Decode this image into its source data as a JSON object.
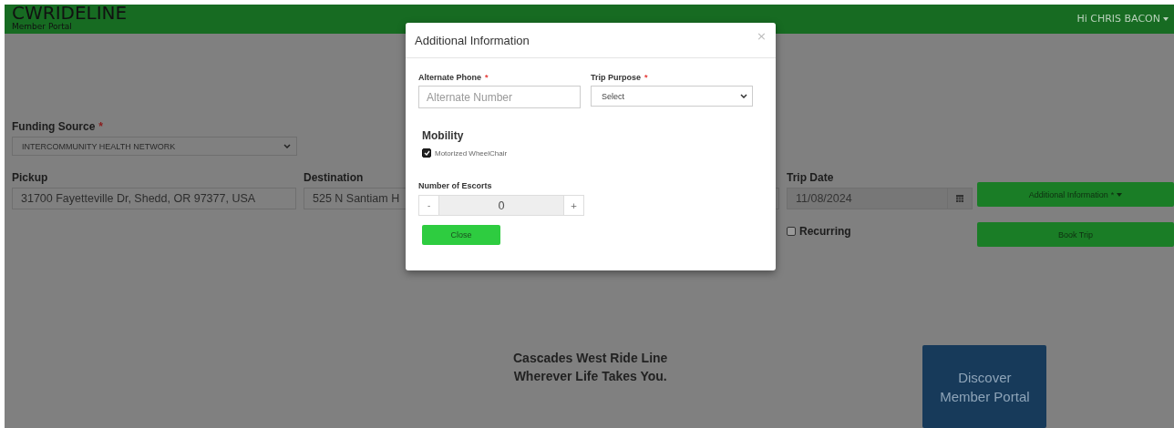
{
  "header": {
    "brand": "CWRIDELINE",
    "subtitle": "Member Portal",
    "user": "Hi CHRIS BACON"
  },
  "form": {
    "funding": {
      "label": "Funding Source",
      "required_mark": "*",
      "value": "INTERCOMMUNITY HEALTH NETWORK"
    },
    "pickup": {
      "label": "Pickup",
      "value": "31700 Fayetteville Dr, Shedd, OR 97377, USA"
    },
    "destination": {
      "label": "Destination",
      "value": "525 N Santiam H"
    },
    "trip_date": {
      "label": "Trip Date",
      "value": "11/08/2024"
    },
    "additional_button": {
      "label": "Additional Information",
      "required_mark": "*"
    },
    "recurring": {
      "label": "Recurring",
      "checked": false
    },
    "book_button": "Book Trip"
  },
  "footer": {
    "lines": [
      "Cascades West Ride Line",
      "Wherever Life Takes You."
    ],
    "discover_button": "Discover Member Portal"
  },
  "modal": {
    "title": "Additional Information",
    "close": "×",
    "alternate_phone": {
      "label": "Alternate Phone",
      "required_mark": "*",
      "placeholder": "Alternate Number"
    },
    "trip_purpose": {
      "label": "Trip Purpose",
      "required_mark": "*",
      "value": "Select"
    },
    "mobility_heading": "Mobility",
    "mobility_options": [
      {
        "label": "Motorized WheelChair",
        "checked": true
      }
    ],
    "escorts": {
      "label": "Number of Escorts",
      "minus": "-",
      "value": "0",
      "plus": "+"
    },
    "close_button": "Close"
  }
}
